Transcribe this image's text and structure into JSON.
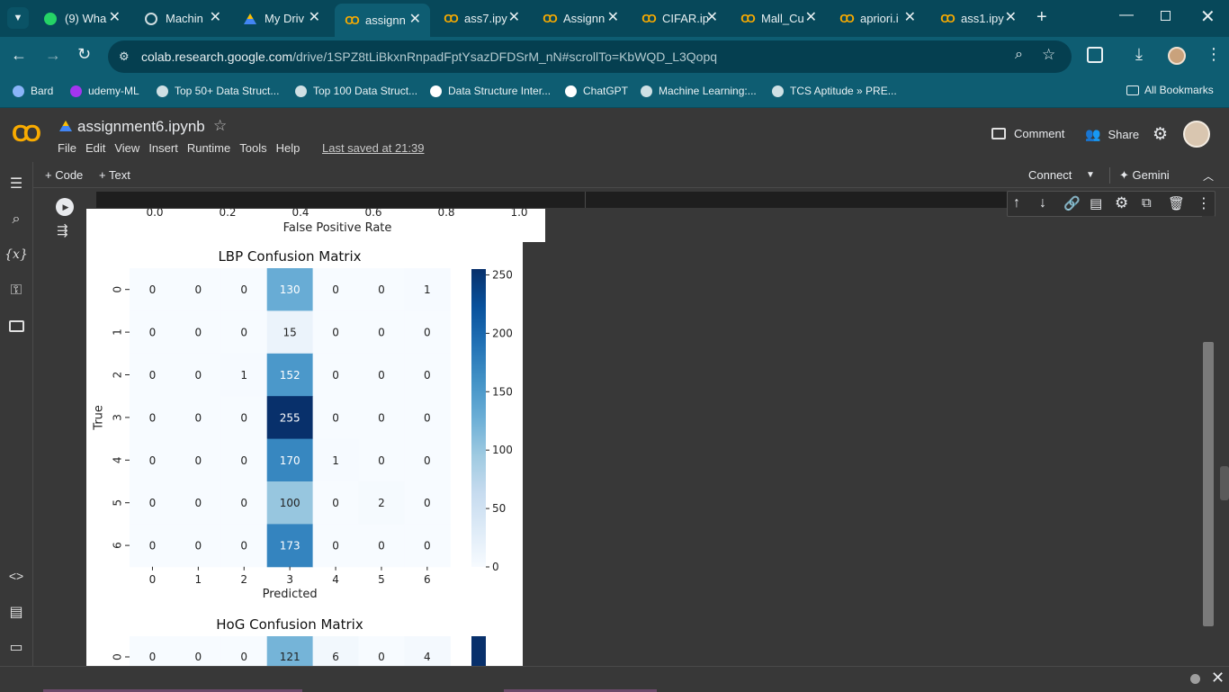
{
  "browser": {
    "tabs": [
      {
        "title": "(9) Wha",
        "icon": "whatsapp-icon"
      },
      {
        "title": "Machin",
        "icon": "globe-icon"
      },
      {
        "title": "My Driv",
        "icon": "drive-icon"
      },
      {
        "title": "assignn",
        "icon": "colab-icon",
        "active": true
      },
      {
        "title": "ass7.ipy",
        "icon": "colab-icon"
      },
      {
        "title": "Assignn",
        "icon": "colab-icon"
      },
      {
        "title": "CIFAR.ip",
        "icon": "colab-icon"
      },
      {
        "title": "Mall_Cu",
        "icon": "colab-icon"
      },
      {
        "title": "apriori.i",
        "icon": "colab-icon"
      },
      {
        "title": "ass1.ipy",
        "icon": "colab-icon"
      }
    ],
    "url_host": "colab.research.google.com",
    "url_path": "/drive/1SPZ8tLiBkxnRnpadFptYsazDFDSrM_nN#scrollTo=KbWQD_L3Qopq",
    "bookmarks": [
      {
        "label": "Bard",
        "icon": "bard-icon"
      },
      {
        "label": "udemy-ML",
        "icon": "udemy-icon"
      },
      {
        "label": "Top 50+ Data Struct...",
        "icon": "bookmark-icon"
      },
      {
        "label": "Top 100 Data Struct...",
        "icon": "bookmark-icon"
      },
      {
        "label": "Data Structure Inter...",
        "icon": "globe-icon"
      },
      {
        "label": "ChatGPT",
        "icon": "chatgpt-icon"
      },
      {
        "label": "Machine Learning:...",
        "icon": "bookmark-icon"
      },
      {
        "label": "TCS Aptitude » PRE...",
        "icon": "bookmark-icon"
      }
    ],
    "all_bookmarks": "All Bookmarks"
  },
  "colab": {
    "logo": "CO",
    "notebook_title": "assignment6.ipynb",
    "menu": [
      "File",
      "Edit",
      "View",
      "Insert",
      "Runtime",
      "Tools",
      "Help"
    ],
    "last_saved": "Last saved at 21:39",
    "comment": "Comment",
    "share": "Share",
    "add_code": "+ Code",
    "add_text": "+ Text",
    "connect": "Connect",
    "gemini": "Gemini"
  },
  "roc_axis": {
    "ticks": [
      "0.0",
      "0.2",
      "0.4",
      "0.6",
      "0.8",
      "1.0"
    ],
    "xlabel": "False Positive Rate"
  },
  "chart_data": [
    {
      "type": "heatmap",
      "title": "LBP Confusion Matrix",
      "xlabel": "Predicted",
      "ylabel": "True",
      "x_ticks": [
        "0",
        "1",
        "2",
        "3",
        "4",
        "5",
        "6"
      ],
      "y_ticks": [
        "0",
        "1",
        "2",
        "3",
        "4",
        "5",
        "6"
      ],
      "values": [
        [
          0,
          0,
          0,
          130,
          0,
          0,
          1
        ],
        [
          0,
          0,
          0,
          15,
          0,
          0,
          0
        ],
        [
          0,
          0,
          1,
          152,
          0,
          0,
          0
        ],
        [
          0,
          0,
          0,
          255,
          0,
          0,
          0
        ],
        [
          0,
          0,
          0,
          170,
          1,
          0,
          0
        ],
        [
          0,
          0,
          0,
          100,
          0,
          2,
          0
        ],
        [
          0,
          0,
          0,
          173,
          0,
          0,
          0
        ]
      ],
      "colorbar_ticks": [
        "250",
        "200",
        "150",
        "100",
        "50",
        "0"
      ],
      "colormap": "Blues",
      "vmin": 0,
      "vmax": 255
    },
    {
      "type": "heatmap",
      "title": "HoG Confusion Matrix",
      "y_ticks": [
        "0"
      ],
      "values": [
        [
          0,
          0,
          0,
          121,
          6,
          0,
          4
        ]
      ],
      "colormap": "Blues"
    }
  ]
}
